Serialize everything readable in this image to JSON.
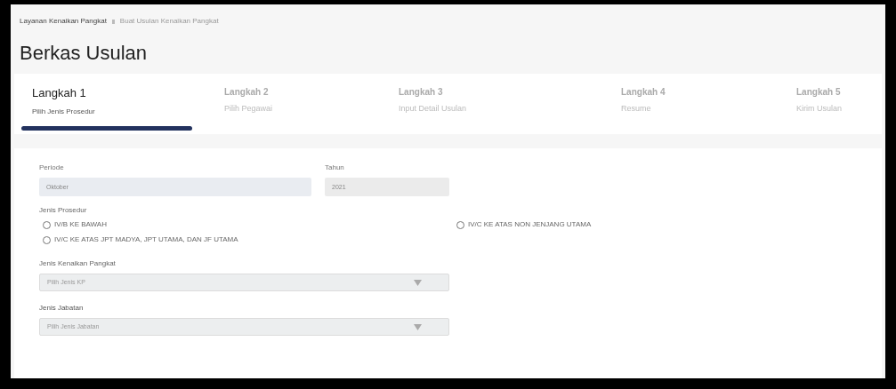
{
  "breadcrumb": [
    {
      "label": "Layanan Kenaikan Pangkat",
      "current": false
    },
    {
      "label": "Buat Usulan Kenaikan Pangkat",
      "current": true
    }
  ],
  "page_title": "Berkas Usulan",
  "steps": [
    {
      "title": "Langkah 1",
      "subtitle": "Pilih Jenis Prosedur",
      "selected": true
    },
    {
      "title": "Langkah 2",
      "subtitle": "Pilih Pegawai",
      "selected": false
    },
    {
      "title": "Langkah 3",
      "subtitle": "Input Detail Usulan",
      "selected": false
    },
    {
      "title": "Langkah 4",
      "subtitle": "Resume",
      "selected": false
    },
    {
      "title": "Langkah 5",
      "subtitle": "Kirim Usulan",
      "selected": false
    }
  ],
  "periode": {
    "label": "Periode",
    "value": "Oktober"
  },
  "tahun": {
    "label": "Tahun",
    "value": "2021"
  },
  "jenis_prosedur": {
    "label": "Jenis Prosedur",
    "options": [
      {
        "label": "IV/B KE BAWAH",
        "selected": false
      },
      {
        "label": "IV/C KE ATAS NON JENJANG UTAMA",
        "selected": false
      },
      {
        "label": "IV/C KE ATAS JPT MADYA, JPT UTAMA, DAN JF UTAMA",
        "selected": false
      }
    ]
  },
  "jenis_kenaikan_pangkat": {
    "label": "Jenis Kenaikan Pangkat",
    "placeholder": "Pilih Jenis KP"
  },
  "jenis_jabatan": {
    "label": "Jenis Jabatan",
    "placeholder": "Pilih Jenis Jabatan"
  }
}
